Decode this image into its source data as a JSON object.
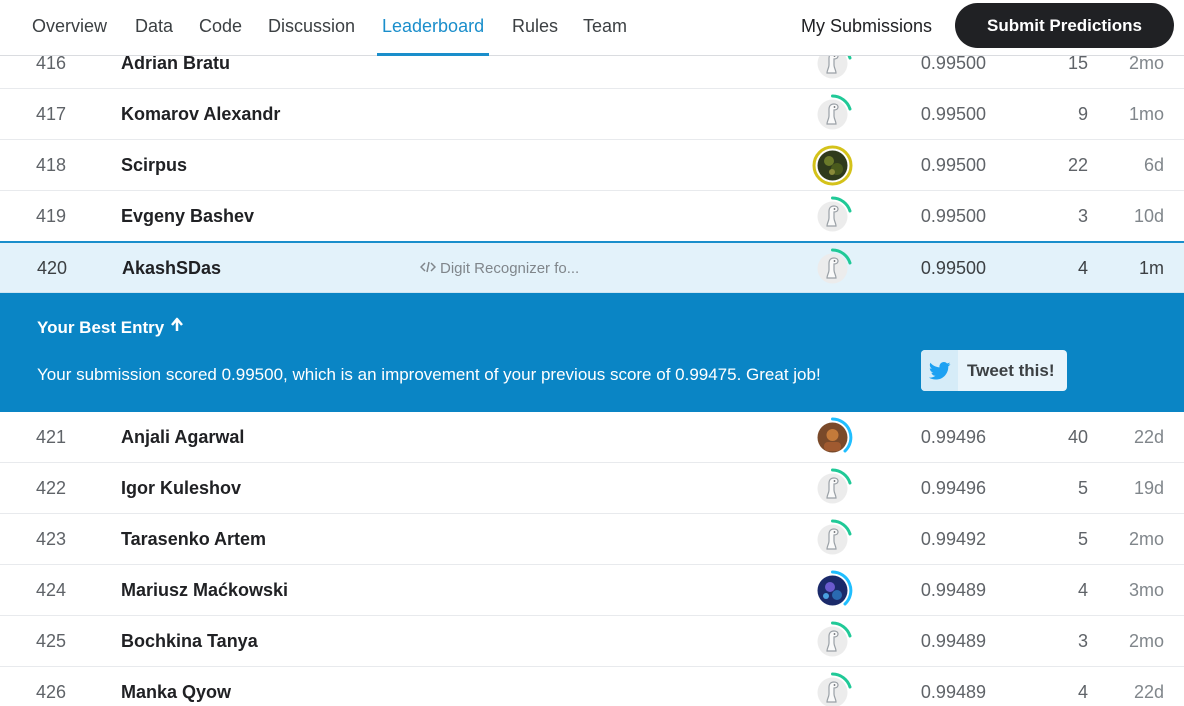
{
  "nav": {
    "tabs": [
      "Overview",
      "Data",
      "Code",
      "Discussion",
      "Leaderboard",
      "Rules",
      "Team"
    ],
    "active_tab": "Leaderboard",
    "my_submissions": "My Submissions",
    "submit_button": "Submit Predictions"
  },
  "rows_before": [
    {
      "rank": "416",
      "name": "Adrian Bratu",
      "score": "0.99500",
      "entries": "15",
      "last": "2mo",
      "avatar": "default-goose"
    },
    {
      "rank": "417",
      "name": "Komarov Alexandr",
      "score": "0.99500",
      "entries": "9",
      "last": "1mo",
      "avatar": "default-goose"
    },
    {
      "rank": "418",
      "name": "Scirpus",
      "score": "0.99500",
      "entries": "22",
      "last": "6d",
      "avatar": "photo-dark"
    },
    {
      "rank": "419",
      "name": "Evgeny Bashev",
      "score": "0.99500",
      "entries": "3",
      "last": "10d",
      "avatar": "default-goose"
    }
  ],
  "my_row": {
    "rank": "420",
    "name": "AkashSDas",
    "notebook": "Digit Recognizer fo...",
    "score": "0.99500",
    "entries": "4",
    "last": "1m",
    "avatar": "default-goose"
  },
  "best_entry": {
    "title": "Your Best Entry",
    "message": "Your submission scored 0.99500, which is an improvement of your previous score of 0.99475. Great job!",
    "tweet_label": "Tweet this!"
  },
  "rows_after": [
    {
      "rank": "421",
      "name": "Anjali Agarwal",
      "score": "0.99496",
      "entries": "40",
      "last": "22d",
      "avatar": "photo-warm"
    },
    {
      "rank": "422",
      "name": "Igor Kuleshov",
      "score": "0.99496",
      "entries": "5",
      "last": "19d",
      "avatar": "default-goose"
    },
    {
      "rank": "423",
      "name": "Tarasenko Artem",
      "score": "0.99492",
      "entries": "5",
      "last": "2mo",
      "avatar": "default-goose"
    },
    {
      "rank": "424",
      "name": "Mariusz Maćkowski",
      "score": "0.99489",
      "entries": "4",
      "last": "3mo",
      "avatar": "photo-blue"
    },
    {
      "rank": "425",
      "name": "Bochkina Tanya",
      "score": "0.99489",
      "entries": "3",
      "last": "2mo",
      "avatar": "default-goose"
    },
    {
      "rank": "426",
      "name": "Manka Qyow",
      "score": "0.99489",
      "entries": "4",
      "last": "22d",
      "avatar": "default-goose"
    }
  ],
  "colors": {
    "accent": "#1a8ecb",
    "banner": "#0a85c5",
    "progress_green": "#20c997",
    "progress_blue": "#20beff",
    "gold_ring": "#d4c21a"
  }
}
